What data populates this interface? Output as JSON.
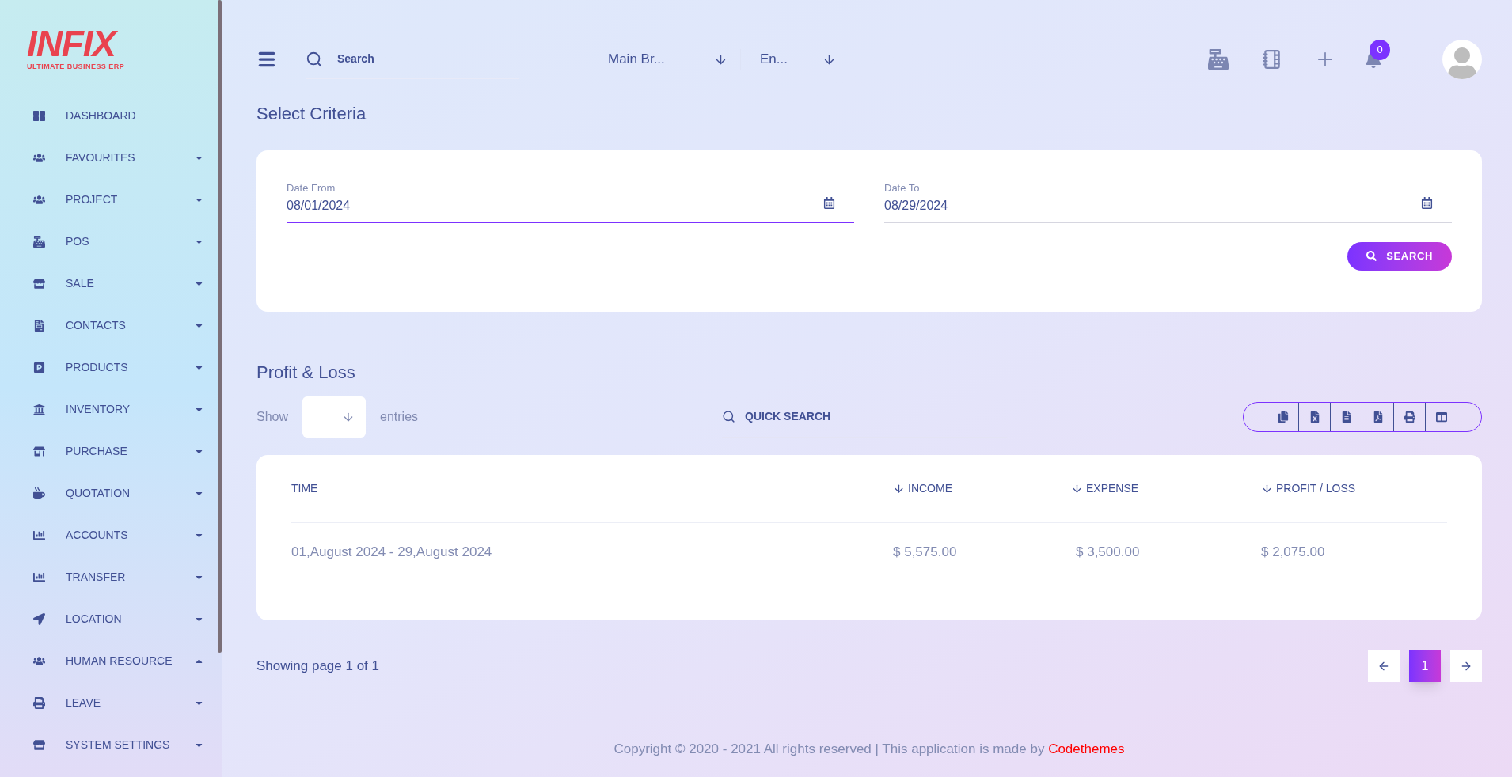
{
  "logo": {
    "name": "INFIX",
    "tagline": "ULTIMATE BUSINESS ERP"
  },
  "sidebar": {
    "items": [
      {
        "label": "DASHBOARD",
        "kind": "link"
      },
      {
        "label": "FAVOURITES",
        "kind": "menu",
        "expanded": false
      },
      {
        "label": "PROJECT",
        "kind": "menu",
        "expanded": false
      },
      {
        "label": "POS",
        "kind": "menu",
        "expanded": false
      },
      {
        "label": "SALE",
        "kind": "menu",
        "expanded": false
      },
      {
        "label": "CONTACTS",
        "kind": "menu",
        "expanded": false
      },
      {
        "label": "PRODUCTS",
        "kind": "menu",
        "expanded": false
      },
      {
        "label": "INVENTORY",
        "kind": "menu",
        "expanded": false
      },
      {
        "label": "PURCHASE",
        "kind": "menu",
        "expanded": false
      },
      {
        "label": "QUOTATION",
        "kind": "menu",
        "expanded": false
      },
      {
        "label": "ACCOUNTS",
        "kind": "menu",
        "expanded": false
      },
      {
        "label": "TRANSFER",
        "kind": "menu",
        "expanded": false
      },
      {
        "label": "LOCATION",
        "kind": "menu",
        "expanded": false
      },
      {
        "label": "HUMAN RESOURCE",
        "kind": "menu",
        "expanded": true
      },
      {
        "label": "LEAVE",
        "kind": "menu",
        "expanded": false
      },
      {
        "label": "SYSTEM SETTINGS",
        "kind": "menu",
        "expanded": false
      }
    ]
  },
  "topbar": {
    "search": {
      "placeholder": "Search"
    },
    "branch": "Main Br...",
    "language": "En...",
    "notification_count": "0"
  },
  "criteria": {
    "title": "Select Criteria",
    "date_from": {
      "label": "Date From",
      "value": "08/01/2024"
    },
    "date_to": {
      "label": "Date To",
      "value": "08/29/2024"
    },
    "search_button": "SEARCH"
  },
  "report": {
    "title": "Profit & Loss",
    "show_label": "Show",
    "entries_label": "entries",
    "quick_search": {
      "placeholder": "QUICK SEARCH"
    },
    "table": {
      "columns": [
        {
          "label": "TIME",
          "sortable": false
        },
        {
          "label": "INCOME",
          "sortable": true
        },
        {
          "label": "EXPENSE",
          "sortable": true
        },
        {
          "label": "PROFIT / LOSS",
          "sortable": true
        }
      ],
      "rows": [
        [
          "01,August 2024 - 29,August 2024",
          "$ 5,575.00",
          "$ 3,500.00",
          "$ 2,075.00"
        ]
      ]
    },
    "pagination": {
      "summary": "Showing page 1 of 1",
      "pages": [
        {
          "label": "1",
          "selected": true
        }
      ]
    }
  },
  "footer": {
    "text": "Copyright © 2020 - 2021 All rights reserved | This application is made by ",
    "link": "Codethemes"
  }
}
